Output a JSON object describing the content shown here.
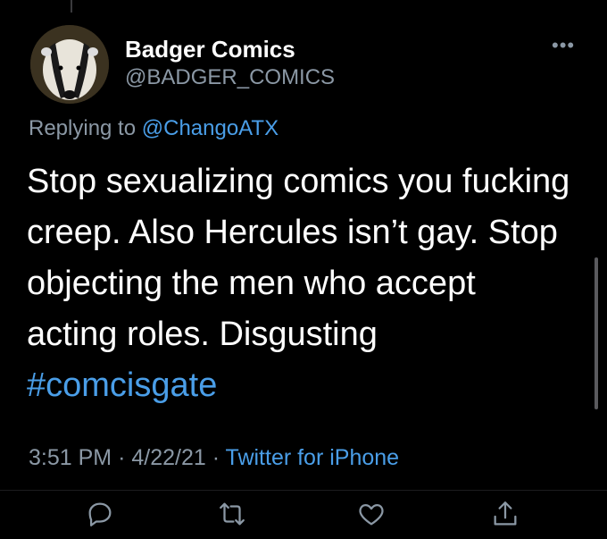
{
  "author": {
    "name": "Badger Comics",
    "handle": "@BADGER_COMICS"
  },
  "reply_prefix": "Replying to",
  "reply_mention": "@ChangoATX",
  "tweet": {
    "lines": [
      "Stop sexualizing comics you fucking",
      "creep. Also Hercules isn’t gay. Stop",
      "objecting the men who accept",
      "acting roles.  Disgusting"
    ],
    "hashtag": "#comcisgate"
  },
  "meta": {
    "time": "3:51 PM",
    "date": "4/22/21",
    "source": "Twitter for iPhone"
  },
  "more_label": "•••",
  "colors": {
    "accent": "#4a9ee8",
    "muted": "#8b98a5",
    "background": "#000000"
  },
  "icons": [
    "comment-icon",
    "retweet-icon",
    "like-icon",
    "share-icon"
  ]
}
